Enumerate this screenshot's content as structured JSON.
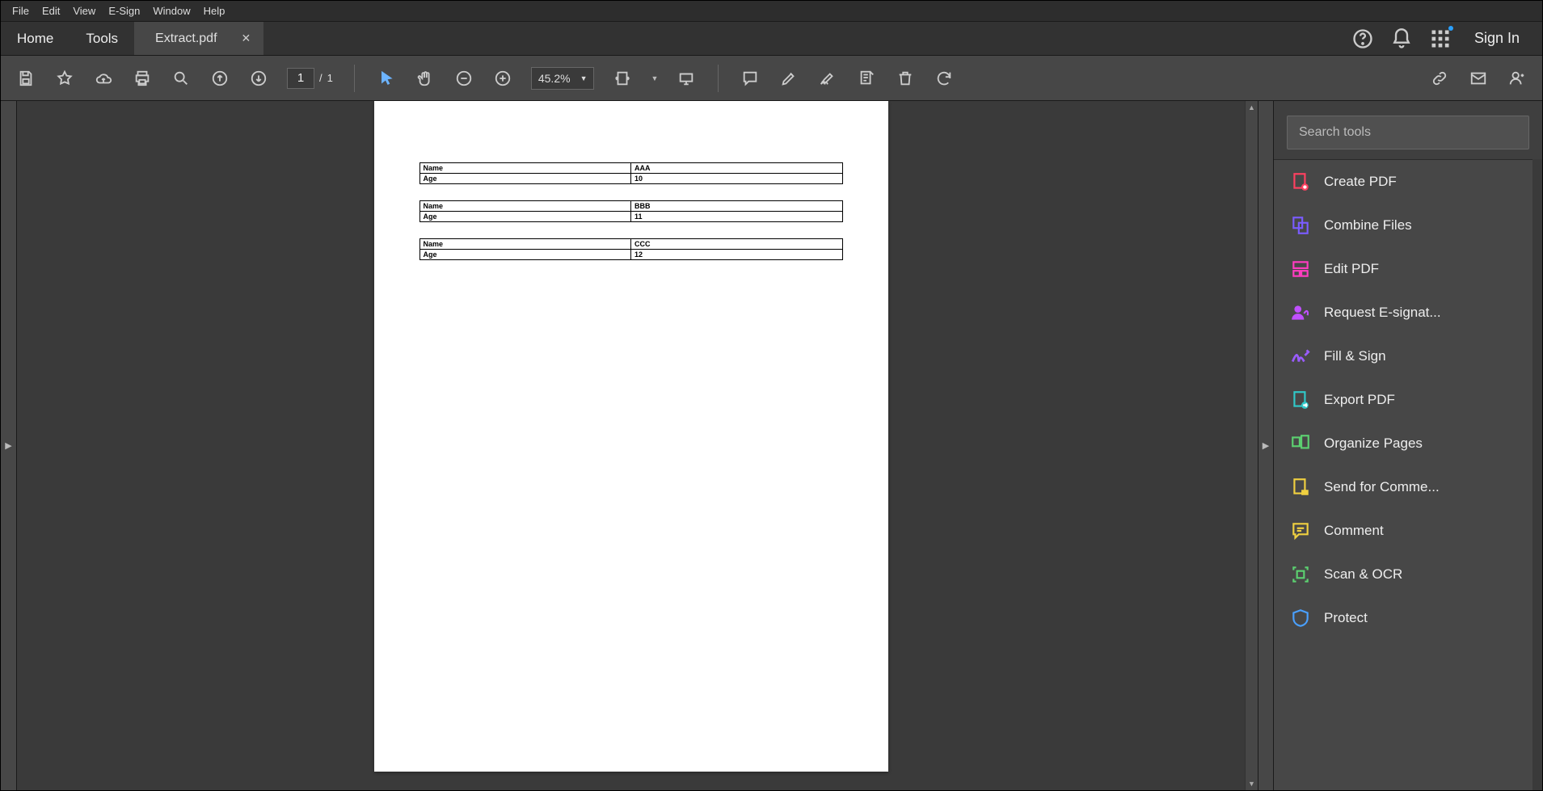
{
  "menu": [
    "File",
    "Edit",
    "View",
    "E-Sign",
    "Window",
    "Help"
  ],
  "tabs": {
    "home": "Home",
    "tools": "Tools",
    "doc": "Extract.pdf"
  },
  "signin": "Sign In",
  "toolbar": {
    "page_current": "1",
    "page_sep": "/",
    "page_total": "1",
    "zoom": "45.2%"
  },
  "search_placeholder": "Search tools",
  "tools": {
    "create": "Create PDF",
    "combine": "Combine Files",
    "edit": "Edit PDF",
    "request": "Request E-signat...",
    "fill": "Fill & Sign",
    "export": "Export PDF",
    "organize": "Organize Pages",
    "send": "Send for Comme...",
    "comment": "Comment",
    "scan": "Scan & OCR",
    "protect": "Protect"
  },
  "pdf": {
    "tables": [
      {
        "rows": [
          [
            "Name",
            "AAA"
          ],
          [
            "Age",
            "10"
          ]
        ]
      },
      {
        "rows": [
          [
            "Name",
            "BBB"
          ],
          [
            "Age",
            "11"
          ]
        ]
      },
      {
        "rows": [
          [
            "Name",
            "CCC"
          ],
          [
            "Age",
            "12"
          ]
        ]
      }
    ]
  }
}
